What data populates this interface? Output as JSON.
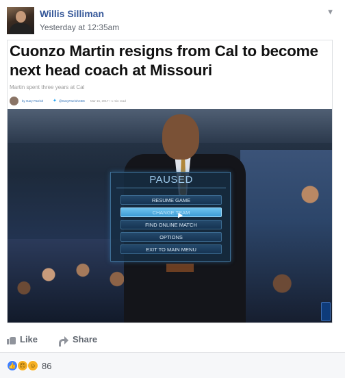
{
  "post": {
    "author": "Willis Silliman",
    "timestamp": "Yesterday at 12:35am"
  },
  "article": {
    "headline": "Cuonzo Martin resigns from Cal to become next head coach at Missouri",
    "subheadline": "Martin spent three years at Cal",
    "byline": {
      "author": "by Gary Parrish",
      "twitter": "@GaryParrishCBS",
      "date": "Mar 15, 2017 • 1 min read"
    }
  },
  "pause_menu": {
    "title": "PAUSED",
    "items": [
      "RESUME GAME",
      "CHANGE TEAM",
      "FIND ONLINE MATCH",
      "OPTIONS",
      "EXIT TO MAIN MENU"
    ],
    "highlighted": "CHANGE TEAM"
  },
  "actions": {
    "like": "Like",
    "share": "Share"
  },
  "reactions": {
    "count": "86",
    "types": [
      "like",
      "sad",
      "haha"
    ]
  },
  "colors": {
    "author_link": "#365899",
    "menu_highlight": "#6fc3ef",
    "like_blue": "#4080ff",
    "emoji_yellow": "#f7b125"
  },
  "icons": {
    "menu": "chevron-down-icon",
    "like": "thumbs-up-icon",
    "share": "share-arrow-icon"
  }
}
